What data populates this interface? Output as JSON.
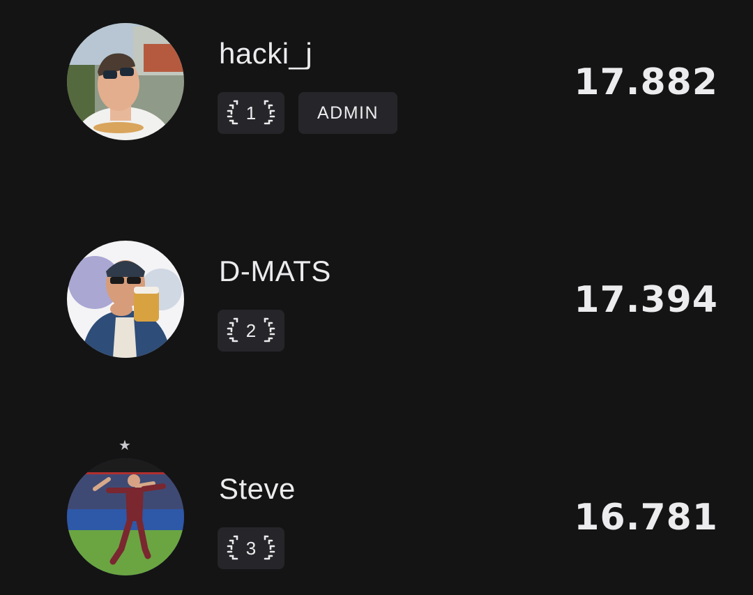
{
  "leaderboard": {
    "entries": [
      {
        "rank": "1",
        "username": "hacki_j",
        "role": "ADMIN",
        "score": "17.882",
        "avatar_icon": "user-photo-avatar",
        "has_star": false
      },
      {
        "rank": "2",
        "username": "D-MATS",
        "role": "",
        "score": "17.394",
        "avatar_icon": "user-photo-avatar",
        "has_star": false
      },
      {
        "rank": "3",
        "username": "Steve",
        "role": "",
        "score": "16.781",
        "avatar_icon": "user-photo-avatar",
        "has_star": true,
        "star_icon": "star-icon"
      }
    ]
  },
  "colors": {
    "background": "#141415",
    "badge_background": "#26262a",
    "text": "#ececee",
    "star": "#c9c9cd"
  }
}
